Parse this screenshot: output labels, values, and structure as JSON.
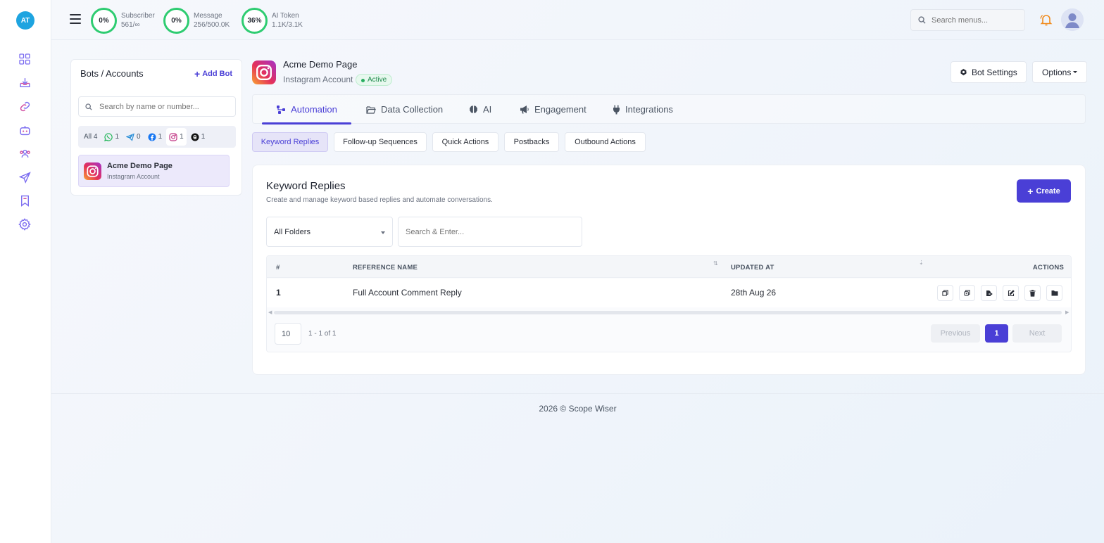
{
  "app": {
    "logo_initials": "AT",
    "footer": "2026 © Scope Wiser"
  },
  "sidebar": {
    "icons": [
      "dashboard-icon",
      "inbox-download-icon",
      "link-icon",
      "bot-icon",
      "users-icon",
      "send-icon",
      "bookmark-icon",
      "settings-icon"
    ]
  },
  "topbar": {
    "stats": [
      {
        "percent": "0%",
        "label": "Subscriber",
        "value": "561/∞"
      },
      {
        "percent": "0%",
        "label": "Message",
        "value": "256/500.0K"
      },
      {
        "percent": "36%",
        "label": "AI Token",
        "value": "1.1K/3.1K"
      }
    ],
    "search_placeholder": "Search menus..."
  },
  "bots": {
    "title": "Bots / Accounts",
    "add_label": "Add Bot",
    "search_placeholder": "Search by name or number...",
    "filters": [
      {
        "icon": "",
        "label": "All",
        "count": "4"
      },
      {
        "icon": "whatsapp-icon",
        "count": "1"
      },
      {
        "icon": "telegram-icon",
        "count": "0"
      },
      {
        "icon": "facebook-icon",
        "count": "1"
      },
      {
        "icon": "instagram-icon",
        "count": "1"
      },
      {
        "icon": "threads-icon",
        "count": "1"
      }
    ],
    "selected": {
      "name": "Acme Demo Page",
      "type": "Instagram Account"
    }
  },
  "page": {
    "title": "Acme Demo Page",
    "subtitle": "Instagram Account",
    "status": "Active",
    "bot_settings_label": "Bot Settings",
    "options_label": "Options"
  },
  "tabs": [
    {
      "label": "Automation",
      "active": true
    },
    {
      "label": "Data Collection"
    },
    {
      "label": "AI"
    },
    {
      "label": "Engagement"
    },
    {
      "label": "Integrations"
    }
  ],
  "subtabs": [
    {
      "label": "Keyword Replies",
      "active": true
    },
    {
      "label": "Follow-up Sequences"
    },
    {
      "label": "Quick Actions"
    },
    {
      "label": "Postbacks"
    },
    {
      "label": "Outbound Actions"
    }
  ],
  "keyword_replies": {
    "title": "Keyword Replies",
    "description": "Create and manage keyword based replies and automate conversations.",
    "create_label": "Create",
    "folder_select": "All Folders",
    "search_placeholder": "Search & Enter...",
    "columns": [
      "#",
      "REFERENCE NAME",
      "UPDATED AT",
      "ACTIONS"
    ],
    "rows": [
      {
        "num": "1",
        "name": "Full Account Comment Reply",
        "updated": "28th Aug 26"
      }
    ],
    "actions": [
      "copy-icon",
      "duplicate-icon",
      "export-icon",
      "edit-icon",
      "delete-icon",
      "folder-icon"
    ],
    "page_size": "10",
    "page_info": "1 - 1 of 1",
    "prev_label": "Previous",
    "current_page": "1",
    "next_label": "Next"
  },
  "colors": {
    "accent": "#4a3fd6",
    "ring": "#2ecc71",
    "logo": "#1ea4e0"
  }
}
